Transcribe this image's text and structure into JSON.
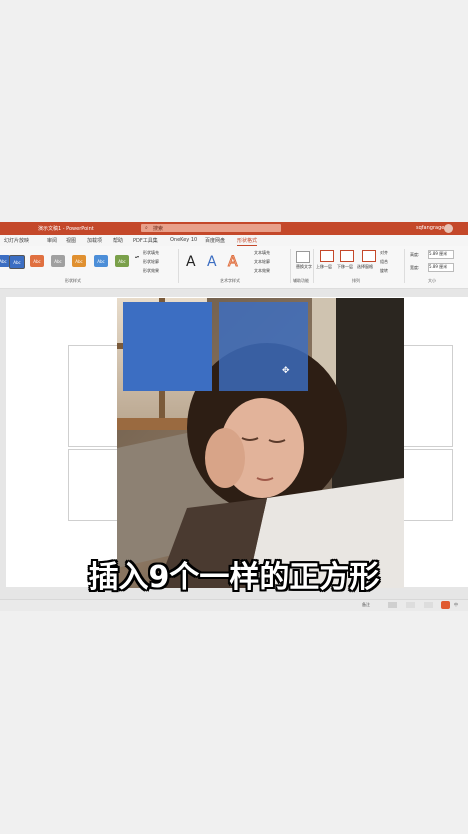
{
  "titlebar": {
    "doc_title": "演示文稿1 - PowerPoint",
    "search_placeholder": "搜索",
    "user": "sqfangrage"
  },
  "tabs": [
    "幻灯片放映",
    "审阅",
    "视图",
    "加载项",
    "帮助",
    "PDF工具集",
    "OneKey 10",
    "百度网盘",
    "形状格式"
  ],
  "ribbon": {
    "shape_styles": [
      "Abc",
      "Abc",
      "Abc",
      "Abc",
      "Abc",
      "Abc"
    ],
    "shape_fill": "形状填充",
    "shape_outline": "形状轮廓",
    "shape_effect": "形状效果",
    "shape_styles_label": "形状样式",
    "wordart_letters": [
      "A",
      "A",
      "A"
    ],
    "text_fill": "文本填充",
    "text_outline": "文本轮廓",
    "text_effect": "文本效果",
    "wordart_label": "艺术字样式",
    "alt_text": "替换文字",
    "accessibility_label": "辅助功能",
    "bring_forward": "上移一层",
    "send_backward": "下移一层",
    "selection_pane": "选择窗格",
    "align": "对齐",
    "group": "组合",
    "rotate": "旋转",
    "arrange_label": "排列",
    "height_label": "高度:",
    "height_value": "5.89 厘米",
    "width_label": "宽度:",
    "width_value": "5.89 厘米",
    "size_label": "大小"
  },
  "status": {
    "notes": "备注",
    "zoom": "中"
  },
  "caption": "插入9个一样的正方形",
  "colors": {
    "accent": "#c4482a",
    "square_fill": "#3c6ec2"
  }
}
